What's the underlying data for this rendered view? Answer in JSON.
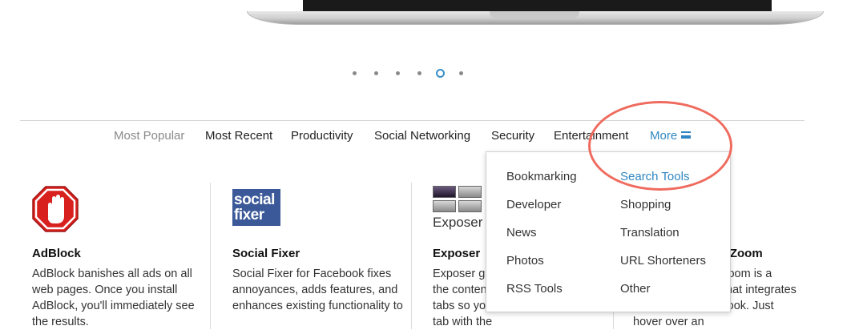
{
  "pager": {
    "count": 6,
    "active_index": 4
  },
  "nav": {
    "items": [
      {
        "label": "Most Popular"
      },
      {
        "label": "Most Recent"
      },
      {
        "label": "Productivity"
      },
      {
        "label": "Social Networking"
      },
      {
        "label": "Security"
      },
      {
        "label": "Entertainment"
      }
    ],
    "more_label": "More"
  },
  "cards": [
    {
      "title": "AdBlock",
      "desc": "AdBlock banishes all ads on all web pages. Once you install AdBlock, you'll immediately see the results."
    },
    {
      "title": "Social Fixer",
      "icon_text": "social fixer",
      "desc": "Social Fixer for Facebook fixes annoyances, adds features, and enhances existing functionality to"
    },
    {
      "title": "Exposer",
      "icon_text": "Exposer",
      "desc": "Exposer gives you a preview of the content of all open Safari tabs so you can quickly find the tab with the"
    },
    {
      "title": "Facebook Photo Zoom",
      "desc": "Facebook Photo Zoom is a simple extension that integrates directly into Facebook. Just hover over an"
    }
  ],
  "dropdown": {
    "left": [
      "Bookmarking",
      "Developer",
      "News",
      "Photos",
      "RSS Tools"
    ],
    "right": [
      "Search Tools",
      "Shopping",
      "Translation",
      "URL Shorteners",
      "Other"
    ],
    "active": "Search Tools"
  },
  "colors": {
    "accent": "#2f86c2",
    "highlight_ring": "#ef6b5e",
    "facebook_blue": "#3b5998"
  }
}
